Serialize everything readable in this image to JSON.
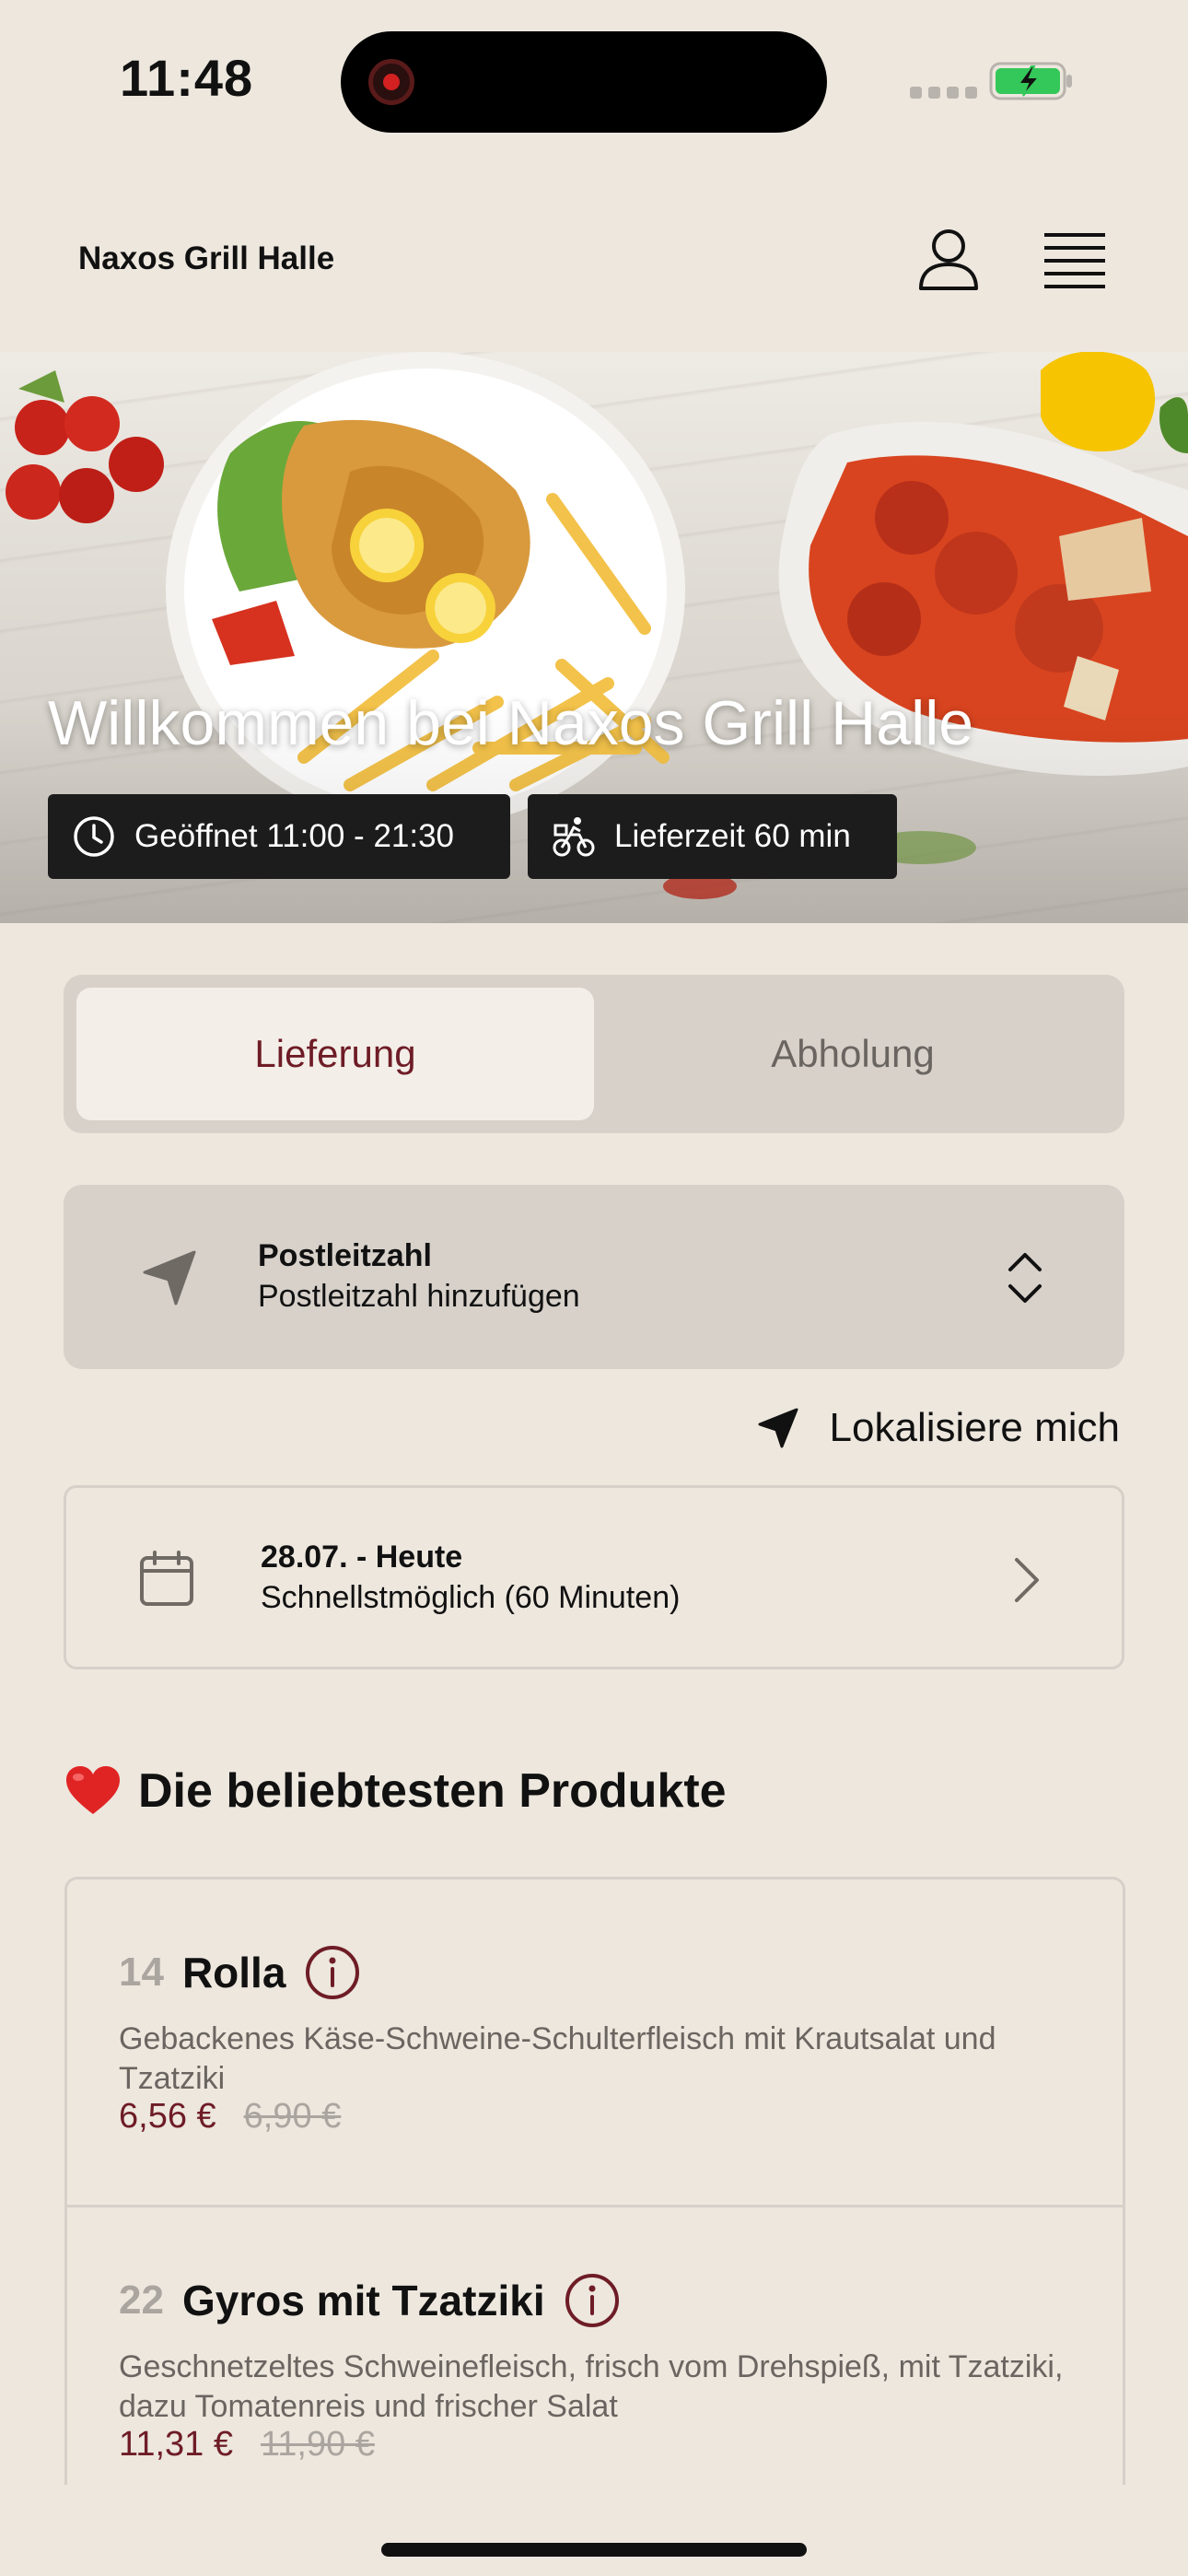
{
  "status_bar": {
    "time": "11:48"
  },
  "header": {
    "brand": "Naxos Grill Halle",
    "user_icon": "user-icon",
    "menu_icon": "menu-icon"
  },
  "hero": {
    "title": "Willkommen bei Naxos Grill Halle",
    "opening_hours": "Geöffnet 11:00 - 21:30",
    "delivery_time": "Lieferzeit 60 min"
  },
  "mode_toggle": {
    "options": [
      "Lieferung",
      "Abholung"
    ],
    "selected": "Lieferung"
  },
  "postcode": {
    "title": "Postleitzahl",
    "subtitle": "Postleitzahl hinzufügen"
  },
  "locate": {
    "label": "Lokalisiere mich"
  },
  "date": {
    "title": "28.07. - Heute",
    "subtitle": "Schnellstmöglich (60 Minuten)"
  },
  "popular": {
    "title": "Die beliebtesten Produkte",
    "products": [
      {
        "number": "14",
        "name": "Rolla",
        "description": "Gebackenes Käse-Schweine-Schulterfleisch mit Krautsalat und Tzatziki",
        "price": "6,56 €",
        "old_price": "6,90 €"
      },
      {
        "number": "22",
        "name": "Gyros mit Tzatziki",
        "description": "Geschnetzeltes Schweinefleisch, frisch vom Drehspieß, mit Tzatziki, dazu Tomatenreis und frischer Salat",
        "price": "11,31 €",
        "old_price": "11,90 €"
      }
    ]
  },
  "colors": {
    "background": "#ede7de",
    "accent": "#6e1c26",
    "panel": "#d7d1ca",
    "badge": "#1c1c1c",
    "battery": "#34c759"
  }
}
